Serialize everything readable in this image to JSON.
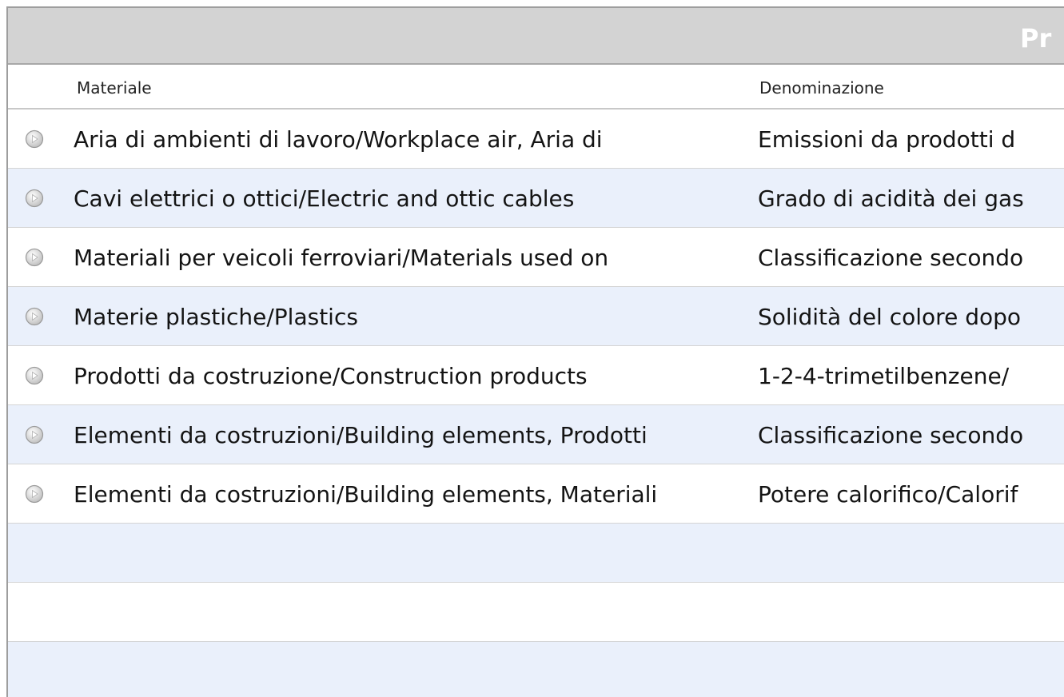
{
  "title": "Pr",
  "columns": {
    "material": "Materiale",
    "denomination": "Denominazione"
  },
  "rows": [
    {
      "material": "Aria di ambienti di lavoro/Workplace air, Aria di",
      "denomination": "Emissioni da prodotti d"
    },
    {
      "material": "Cavi elettrici o ottici/Electric and ottic cables",
      "denomination": "Grado di acidità dei gas"
    },
    {
      "material": "Materiali per veicoli ferroviari/Materials used on",
      "denomination": "Classificazione secondo"
    },
    {
      "material": "Materie plastiche/Plastics",
      "denomination": "Solidità del colore dopo"
    },
    {
      "material": "Prodotti da costruzione/Construction products",
      "denomination": "1-2-4-trimetilbenzene/"
    },
    {
      "material": "Elementi da costruzioni/Building elements, Prodotti",
      "denomination": "Classificazione secondo"
    },
    {
      "material": "Elementi da costruzioni/Building elements, Materiali",
      "denomination": "Potere calorifico/Calorif"
    }
  ],
  "row_icon": "play-circle-icon",
  "colors": {
    "title_bar": "#d3d3d3",
    "row_alt": "#eaf0fb"
  }
}
